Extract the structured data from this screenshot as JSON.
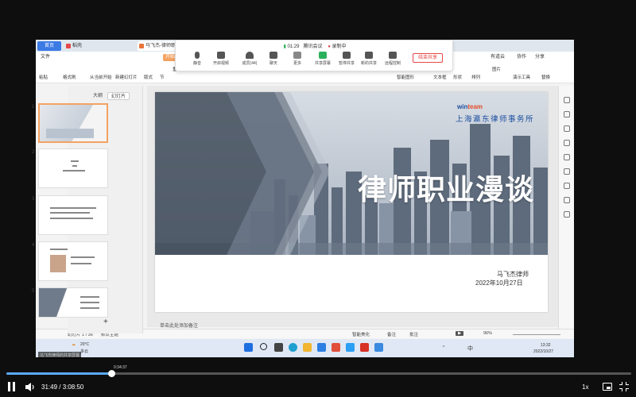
{
  "app": {
    "tabs": [
      {
        "label": "首页"
      },
      {
        "label": "稻壳"
      },
      {
        "label": "马飞杰-律师职..."
      }
    ],
    "ribbon_menu": [
      "文件",
      "开始"
    ],
    "ribbon_right": [
      "有道云",
      "协作",
      "分享"
    ],
    "ribbon_left": [
      "粘贴",
      "格式刷",
      "从当前开始",
      "新建幻灯片",
      "版式",
      "节",
      "重置",
      "文本框",
      "形状",
      "排列",
      "演示工具",
      "替换",
      "图片",
      "智能图形"
    ]
  },
  "meeting": {
    "time": "01:29",
    "title": "腾讯会议",
    "recording": "录制中",
    "buttons": [
      "静音",
      "开启视频",
      "成员(44)",
      "聊天",
      "共享屏幕",
      "暂停共享",
      "新的共享",
      "远程控制",
      "更多"
    ],
    "end_share": "结束共享"
  },
  "left_panel": {
    "tabs": [
      "大纲",
      "幻灯片"
    ],
    "slides": [
      "1",
      "2",
      "3",
      "4",
      "5"
    ],
    "add_label": "+"
  },
  "slide": {
    "brand_prefix": "win",
    "brand_suffix": "team",
    "firm": "上海瀛东律师事务所",
    "title": "律师职业漫谈",
    "speaker": "马飞杰律师",
    "date": "2022年10月27日"
  },
  "notes_placeholder": "单击此处添加备注",
  "statusbar": {
    "slide_count": "幻灯片 1 / 36",
    "theme": "默认主题",
    "beautify": "智能美化",
    "notes": "备注",
    "comments": "批注",
    "zoom": "96%"
  },
  "taskbar": {
    "weather_temp": "20°C",
    "weather_desc": "多云",
    "lang": "中",
    "clock_time": "13:32",
    "clock_date": "2022/10/27"
  },
  "player": {
    "file_label": "马飞杰律师的共享屏幕",
    "hover_time": "0:34:37",
    "current_time": "31:49",
    "total_time": "3:08:50",
    "time_display": "31:49 / 3:08:50",
    "progress": 0.1685,
    "speed": "1x"
  },
  "colors": {
    "accent": "#3c7ae4",
    "progress": "#5aa9f8",
    "firm_blue": "#1b4fa0"
  }
}
